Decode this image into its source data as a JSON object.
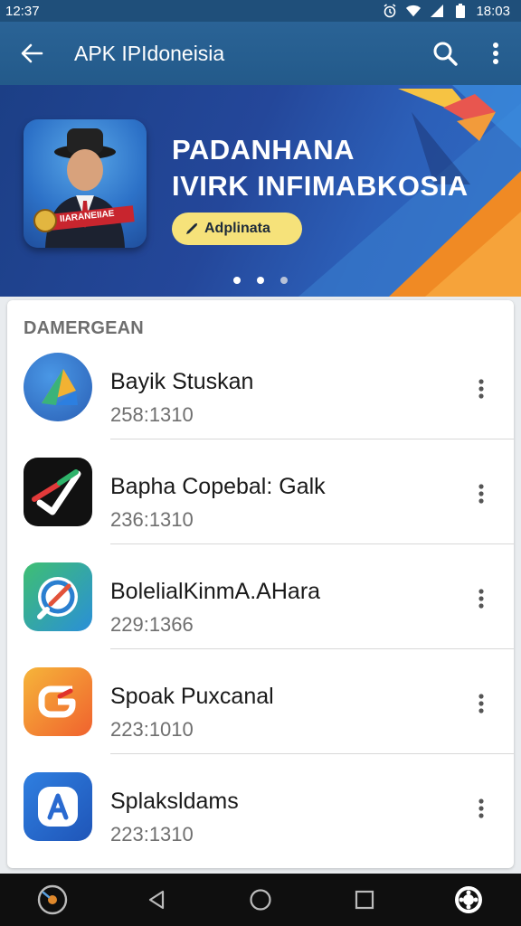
{
  "status_bar": {
    "left_time": "12:37",
    "right_time": "18:03",
    "icons": [
      "alarm-icon",
      "wifi-icon",
      "signal-icon",
      "battery-icon"
    ]
  },
  "app_bar": {
    "title": "APK IPIdoneisia",
    "actions": [
      "back-icon",
      "search-icon",
      "more-vert-icon"
    ]
  },
  "banner": {
    "title_line1": "PADANHANA",
    "title_line2": "IVIRK INFIMABKOSIA",
    "image_badge": "IIARANEIIAE",
    "chip_label": "Adplinata",
    "page_count": 3,
    "active_page": 1
  },
  "section": {
    "label": "DAMERGEAN"
  },
  "apps": [
    {
      "name": "Bayik Stuskan",
      "meta": "258:1310",
      "icon": "app-icon-blue-arrow"
    },
    {
      "name": "Bapha Copebal: Galk",
      "meta": "236:1310",
      "icon": "app-icon-black-check"
    },
    {
      "name": "BolelialKinmA.AHara",
      "meta": "229:1366",
      "icon": "app-icon-compass"
    },
    {
      "name": "Spoak Puxcanal",
      "meta": "223:1010",
      "icon": "app-icon-orange-g"
    },
    {
      "name": "Splaksldams",
      "meta": "223:1310",
      "icon": "app-icon-blue-a"
    }
  ],
  "nav_bar": {
    "buttons": [
      "app-launcher-icon",
      "nav-back-icon",
      "nav-home-icon",
      "nav-recents-icon",
      "settings-gear-icon"
    ]
  },
  "colors": {
    "app_bar": "#2a6396",
    "banner": "#24479a",
    "chip": "#f6e27a",
    "nav_bar": "#0f0f0f"
  }
}
